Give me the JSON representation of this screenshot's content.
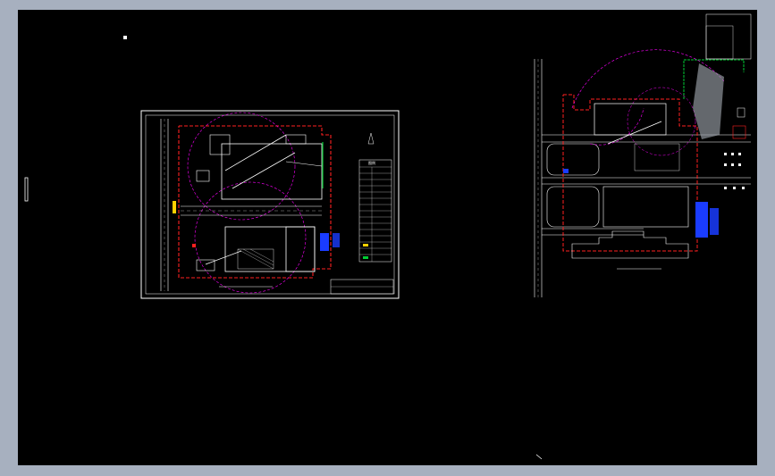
{
  "app": {
    "name": "",
    "canvas_background": "#000000",
    "window_background": "#a7b0bf"
  },
  "colors": {
    "line": "#ffffff",
    "red_boundary": "#ff2020",
    "magenta_radius": "#ff00ff",
    "green_path": "#00cc33",
    "blue_fill": "#1a3cff",
    "yellow_mark": "#ffd000",
    "gray_road": "#9aa0a8"
  },
  "drawing_left": {
    "legend_title": "图例",
    "legend_items": [
      "",
      "",
      "",
      "",
      "",
      "",
      "",
      "",
      "",
      "",
      "",
      "",
      "",
      "",
      ""
    ],
    "title_block": ""
  },
  "drawing_right": {
    "title": ""
  },
  "stray_marks": {
    "top_left": "",
    "left_edge": ""
  }
}
